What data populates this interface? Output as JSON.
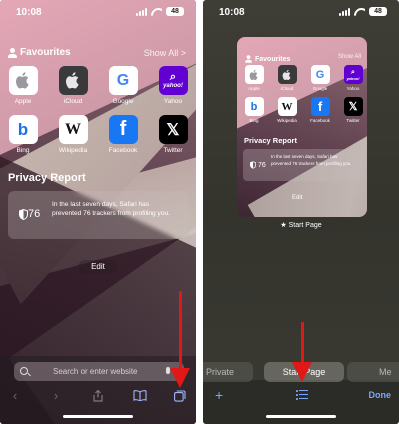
{
  "left": {
    "status": {
      "time": "10:08",
      "battery": "48"
    },
    "favourites": {
      "title": "Favourites",
      "show_all": "Show All >",
      "items": [
        {
          "label": "Apple",
          "icon": "apple-icon"
        },
        {
          "label": "iCloud",
          "icon": "icloud-icon"
        },
        {
          "label": "Google",
          "icon": "google-icon"
        },
        {
          "label": "Yahoo",
          "icon": "yahoo-icon"
        },
        {
          "label": "Bing",
          "icon": "bing-icon"
        },
        {
          "label": "Wikipedia",
          "icon": "wikipedia-icon"
        },
        {
          "label": "Facebook",
          "icon": "facebook-icon"
        },
        {
          "label": "Twitter",
          "icon": "x-twitter-icon"
        }
      ]
    },
    "privacy": {
      "title": "Privacy Report",
      "count": "76",
      "text": "In the last seven days, Safari has prevented 76 trackers from profiling you."
    },
    "edit_label": "Edit",
    "search": {
      "placeholder": "Search or enter website"
    }
  },
  "right": {
    "status": {
      "time": "10:08",
      "battery": "48"
    },
    "thumbnail": {
      "fav_title": "Favourites",
      "show_all": "Show All",
      "items": [
        {
          "label": "Apple"
        },
        {
          "label": "iCloud"
        },
        {
          "label": "Google"
        },
        {
          "label": "Yahoo"
        },
        {
          "label": "Bing"
        },
        {
          "label": "Wikipedia"
        },
        {
          "label": "Facebook"
        },
        {
          "label": "Twitter"
        }
      ],
      "privacy_title": "Privacy Report",
      "privacy_count": "76",
      "privacy_text": "In the last seven days, Safari has prevented 76 trackers from profiling you.",
      "edit_label": "Edit"
    },
    "caption": "Start Page",
    "tab_groups": [
      {
        "label": "Private"
      },
      {
        "label": "Start Page"
      },
      {
        "label": "Me"
      }
    ],
    "done_label": "Done",
    "new_tab_glyph": "+"
  },
  "icons": {
    "google_glyph": "G",
    "bing_glyph": "b",
    "wiki_glyph": "W",
    "facebook_glyph": "f",
    "x_glyph": "𝕏",
    "yahoo_word": "yahoo!",
    "star_glyph": "★"
  },
  "colors": {
    "accent_blue": "#79a7ff",
    "annotation_red": "#e01818",
    "yahoo_purple": "#6001d2",
    "facebook_blue": "#1877f2"
  }
}
